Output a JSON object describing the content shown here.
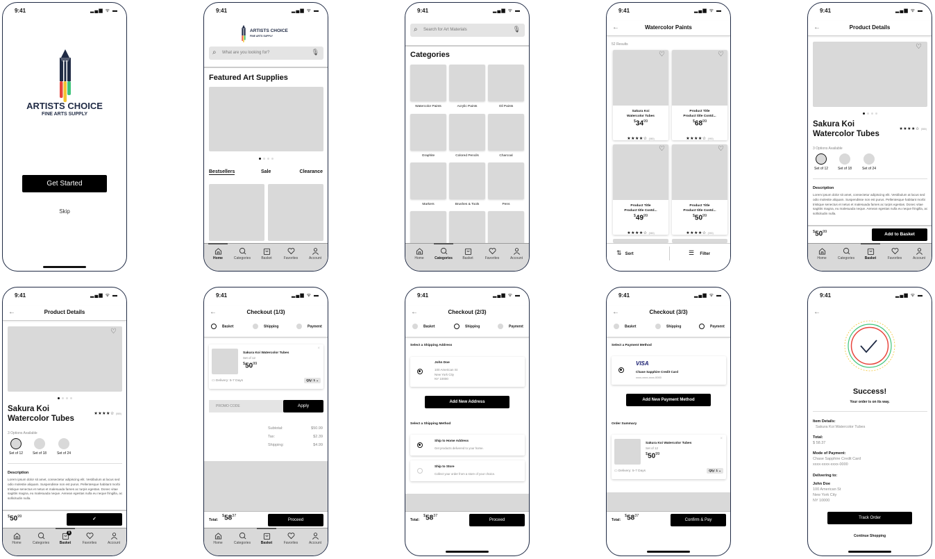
{
  "status": {
    "time": "9:41",
    "icons": "▂▄▆ ᯤ ▬"
  },
  "tabbar": {
    "items": [
      {
        "label": "Home"
      },
      {
        "label": "Categories"
      },
      {
        "label": "Basket"
      },
      {
        "label": "Favorites"
      },
      {
        "label": "Account"
      }
    ]
  },
  "brand": {
    "name": "ARTISTS CHOICE",
    "tagline": "FINE ARTS SUPPLY",
    "colors": {
      "navy": "#1f2a44",
      "red": "#e8443c",
      "yellow": "#f4c430",
      "green": "#3ec47a"
    }
  },
  "splash": {
    "cta": "Get Started",
    "skip": "Skip"
  },
  "home": {
    "search_placeholder": "What are you looking for?",
    "featured_title": "Featured Art Supplies",
    "tabs": [
      "Bestsellers",
      "Sale",
      "Clearance"
    ]
  },
  "categories": {
    "search_placeholder": "Search for Art Materials",
    "title": "Categories",
    "items": [
      "Watercolor Paints",
      "Acrylic Paints",
      "Oil Paints",
      "Graphite",
      "Colored Pencils",
      "Charcoal",
      "Markers",
      "Brushes & Tools",
      "Pens"
    ]
  },
  "results": {
    "title": "Watercolor Paints",
    "count": "52 Results",
    "sort": "Sort",
    "filter": "Filter",
    "items": [
      {
        "line1": "Sakura Koi",
        "line2": "Watercolor Tubes",
        "dollars": "34",
        "cents": "99",
        "rating": 4,
        "reviews": "(580)"
      },
      {
        "line1": "Product Title",
        "line2": "Product title Contd...",
        "dollars": "68",
        "cents": "99",
        "rating": 4,
        "reviews": "(990)"
      },
      {
        "line1": "Product Title",
        "line2": "Product title Contd...",
        "dollars": "49",
        "cents": "99",
        "rating": 4,
        "reviews": "(580)"
      },
      {
        "line1": "Product Title",
        "line2": "Product title Contd...",
        "dollars": "50",
        "cents": "99",
        "rating": 4,
        "reviews": "(990)"
      }
    ]
  },
  "product": {
    "header": "Product Details",
    "name_line1": "Sakura Koi",
    "name_line2": "Watercolor Tubes",
    "rating": 4,
    "reviews": "(580)",
    "options_label": "3 Options Available",
    "options": [
      "Set of 12",
      "Set of 18",
      "Set of 24"
    ],
    "description_label": "Description",
    "description": "Lorem ipsum dolor sit amet, consectetur adipiscing elit. Vestibulum at lacus sed odio molestie aliquam. Suspendisse non est purus. Pellentesque habitant morbi tristique senectus et netus et malesuada fames ac turpis egestas. Donec vitae sagittis magna, eu malesuada neque. Aenean egestas nulla eu neque fringilla, ac sollicitudin nulla.",
    "currency": "$",
    "dollars": "50",
    "cents": "99",
    "add_label": "Add to Basket",
    "basket_badge": "1"
  },
  "checkout": {
    "steps": [
      "Basket",
      "Shipping",
      "Payment"
    ],
    "titles": [
      "Checkout (1/3)",
      "Checkout (2/3)",
      "Checkout (3/3)"
    ],
    "item": {
      "name": "Sakura Koi Watercolor Tubes",
      "variant": "Set of 12",
      "dollars": "50",
      "cents": "99",
      "delivery": "Delivery: 5-7 Days",
      "qty": "Qty: 1"
    },
    "promo_placeholder": "PROMO CODE",
    "apply": "Apply",
    "summary": [
      {
        "label": "Subtotal:",
        "value": "$50.99"
      },
      {
        "label": "Tax:",
        "value": "$2.39"
      },
      {
        "label": "Shipping:",
        "value": "$4.99"
      }
    ],
    "total_label": "Total:",
    "total_dollars": "58",
    "total_cents": "37",
    "proceed": "Proceed",
    "confirm": "Confirm & Pay",
    "address_heading": "Select a Shipping Address",
    "address": {
      "name": "John Doe",
      "line1": "100 American St",
      "line2": "New York City",
      "line3": "NY 10000"
    },
    "add_address": "Add New Address",
    "method_heading": "Select a Shipping Method",
    "methods": [
      {
        "title": "Ship to Home Address",
        "sub": "Get products delivered to your home."
      },
      {
        "title": "Ship to Store",
        "sub": "Collect your order from a store of your choice."
      }
    ],
    "payment_heading": "Select a Payment Method",
    "card": {
      "brand": "VISA",
      "name": "Chase Sapphire Credit Card",
      "number": "xxxx-xxxx-xxxx-0000"
    },
    "add_payment": "Add New Payment Method",
    "order_summary": "Order Summary"
  },
  "success": {
    "title": "Success!",
    "subtitle": "Your order is on its way.",
    "item_label": "Item Details:",
    "item": "Sakura Koi Watercolor Tubes",
    "total_label": "Total:",
    "total": "$ 58.37",
    "payment_label": "Mode of Payment:",
    "payment_name": "Chase Sapphire Credit Card",
    "payment_number": "xxxx-xxxx-xxxx-0000",
    "deliver_label": "Delivering to:",
    "name": "John Doe",
    "line1": "100 American St",
    "line2": "New York City",
    "line3": "NY 10000",
    "track": "Track Order",
    "continue": "Continue Shopping"
  }
}
